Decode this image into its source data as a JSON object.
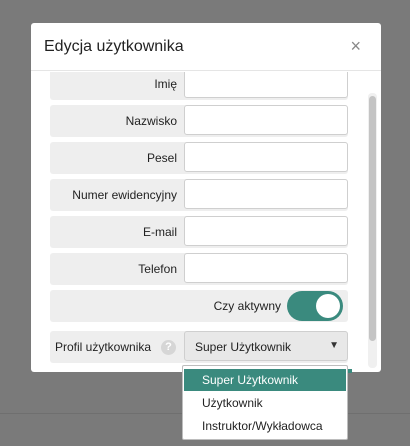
{
  "modal": {
    "title": "Edycja użytkownika",
    "close_label": "×"
  },
  "fields": [
    {
      "label": "Imię",
      "value": ""
    },
    {
      "label": "Nazwisko",
      "value": ""
    },
    {
      "label": "Pesel",
      "value": ""
    },
    {
      "label": "Numer ewidencyjny",
      "value": ""
    },
    {
      "label": "E-mail",
      "value": ""
    },
    {
      "label": "Telefon",
      "value": ""
    }
  ],
  "active_toggle": {
    "label": "Czy aktywny",
    "on": true
  },
  "profile": {
    "label": "Profil użytkownika",
    "help_icon": "?",
    "selected": "Super Użytkownik",
    "arrow": "▼",
    "options": [
      "Super Użytkownik",
      "Użytkownik",
      "Instruktor/Wykładowca"
    ]
  },
  "colors": {
    "accent": "#3a8a7e",
    "overlay": "#7a7a7a"
  }
}
